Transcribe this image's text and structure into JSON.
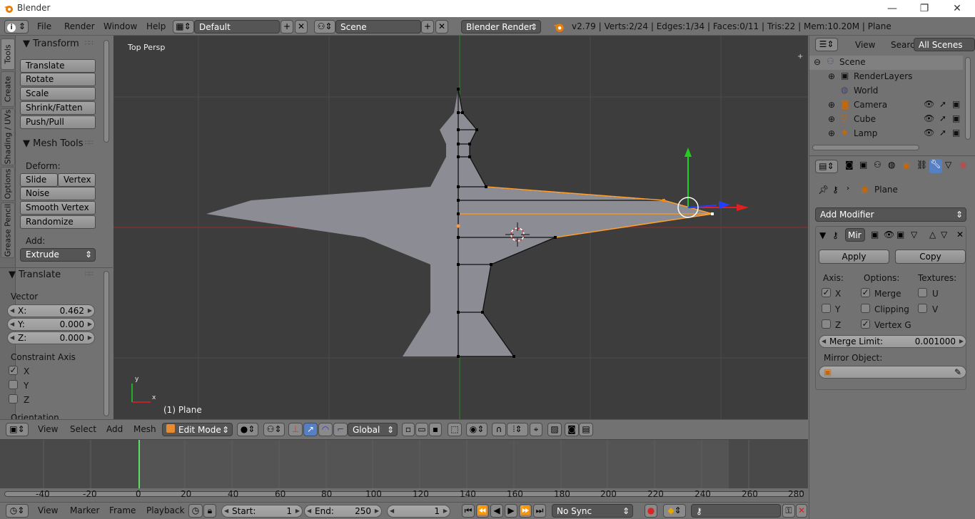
{
  "window": {
    "title": "Blender",
    "minimize": "—",
    "maximize": "❐",
    "close": "✕"
  },
  "menu": {
    "file": "File",
    "render": "Render",
    "window": "Window",
    "help": "Help"
  },
  "layout_field": "Default",
  "scene_field": "Scene",
  "engine": "Blender Render",
  "stats": "v2.79 | Verts:2/24 | Edges:1/34 | Faces:0/11 | Tris:22 | Mem:10.20M | Plane",
  "tabs": [
    "Tools",
    "Create",
    "Shading / UVs",
    "Options",
    "Grease Pencil"
  ],
  "toolshelf": {
    "transform_header": "Transform",
    "transform_buttons": [
      "Translate",
      "Rotate",
      "Scale",
      "Shrink/Fatten",
      "Push/Pull"
    ],
    "mesh_tools_header": "Mesh Tools",
    "deform_label": "Deform:",
    "slide_edge": "Slide Ed",
    "vertex": "Vertex",
    "noise": "Noise",
    "smooth_vertex": "Smooth Vertex",
    "randomize": "Randomize",
    "add_label": "Add:",
    "extrude": "Extrude"
  },
  "operator": {
    "header": "Translate",
    "vector_label": "Vector",
    "x": {
      "label": "X:",
      "value": "0.462"
    },
    "y": {
      "label": "Y:",
      "value": "0.000"
    },
    "z": {
      "label": "Z:",
      "value": "0.000"
    },
    "constraint_label": "Constraint Axis",
    "cx": "X",
    "cy": "Y",
    "cz": "Z",
    "orientation_label": "Orientation"
  },
  "viewport": {
    "view_name": "Top Persp",
    "object_label": "(1) Plane",
    "axis_x": "x",
    "axis_y": "y"
  },
  "view_header": {
    "view": "View",
    "select": "Select",
    "add": "Add",
    "mesh": "Mesh",
    "mode": "Edit Mode",
    "orientation": "Global"
  },
  "timeline": {
    "ticks": [
      "-40",
      "-20",
      "0",
      "20",
      "40",
      "60",
      "80",
      "100",
      "120",
      "140",
      "160",
      "180",
      "200",
      "220",
      "240",
      "260",
      "280"
    ],
    "view": "View",
    "marker": "Marker",
    "frame": "Frame",
    "playback": "Playback",
    "start_label": "Start:",
    "start_value": "1",
    "end_label": "End:",
    "end_value": "250",
    "current_frame": "1",
    "sync": "No Sync"
  },
  "outliner": {
    "view": "View",
    "search": "Search",
    "scenes": "All Scenes",
    "items": [
      "Scene",
      "RenderLayers",
      "World",
      "Camera",
      "Cube",
      "Lamp"
    ]
  },
  "properties": {
    "object_name": "Plane",
    "add_modifier": "Add Modifier",
    "modifier_name": "Mir",
    "apply": "Apply",
    "copy": "Copy",
    "axis_label": "Axis:",
    "options_label": "Options:",
    "textures_label": "Textures:",
    "ax_x": "X",
    "ax_y": "Y",
    "ax_z": "Z",
    "merge": "Merge",
    "clipping": "Clipping",
    "vertex_g": "Vertex G",
    "tex_u": "U",
    "tex_v": "V",
    "merge_limit_label": "Merge Limit:",
    "merge_limit_value": "0.001000",
    "mirror_object_label": "Mirror Object:"
  },
  "colors": {
    "accent": "#5680c2",
    "selected_edge": "#ffa030",
    "x_axis": "#e02020",
    "y_axis": "#20d020",
    "z_axis": "#2040ff"
  }
}
